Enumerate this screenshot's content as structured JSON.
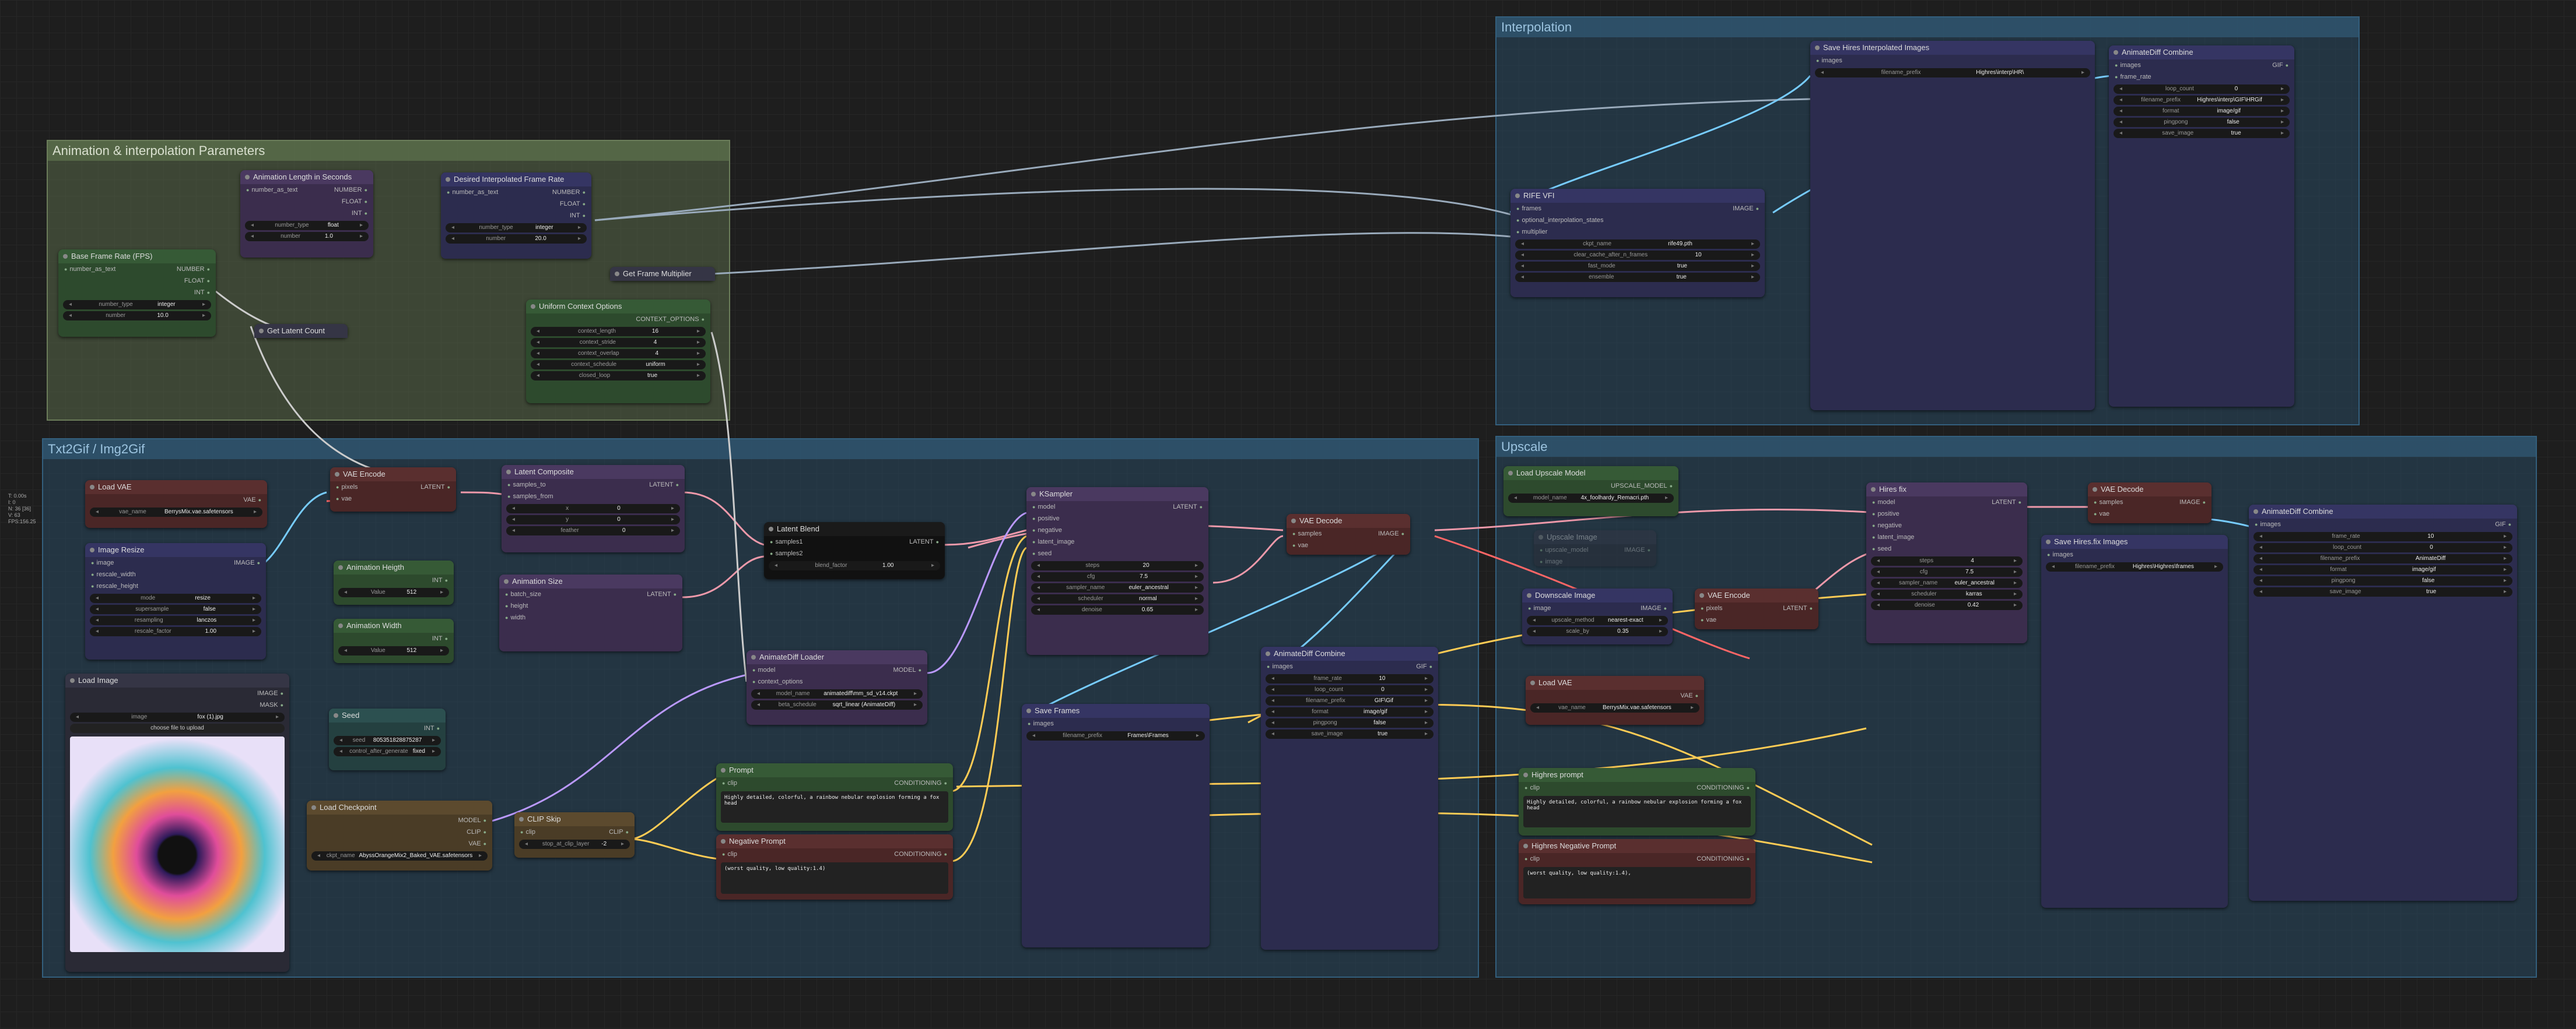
{
  "groups": {
    "interpolation": "Interpolation",
    "anim_params": "Animation & interpolation Parameters",
    "txt2gif": "Txt2Gif / Img2Gif",
    "upscale": "Upscale"
  },
  "sidebar": [
    "T: 0.00s",
    "I: 0",
    "N: 36 [36]",
    "V: 63",
    "FPS:156.25"
  ],
  "nodes": {
    "anim_length": {
      "title": "Animation Length in Seconds",
      "in": "number_as_text",
      "outs": [
        "NUMBER",
        "FLOAT",
        "INT"
      ],
      "w": [
        [
          "number_type",
          "float"
        ],
        [
          "number",
          "1.0"
        ]
      ]
    },
    "desired_fps": {
      "title": "Desired Interpolated Frame Rate",
      "in": "number_as_text",
      "outs": [
        "NUMBER",
        "FLOAT",
        "INT"
      ],
      "w": [
        [
          "number_type",
          "integer"
        ],
        [
          "number",
          "20.0"
        ]
      ]
    },
    "base_fps": {
      "title": "Base Frame Rate (FPS)",
      "in": "number_as_text",
      "outs": [
        "NUMBER",
        "FLOAT",
        "INT"
      ],
      "w": [
        [
          "number_type",
          "integer"
        ],
        [
          "number",
          "10.0"
        ]
      ]
    },
    "latent_count": {
      "title": "Get Latent Count"
    },
    "frame_mult": {
      "title": "Get Frame Multiplier"
    },
    "uniform_ctx": {
      "title": "Uniform Context Options",
      "out": "CONTEXT_OPTIONS",
      "w": [
        [
          "context_length",
          "16"
        ],
        [
          "context_stride",
          "4"
        ],
        [
          "context_overlap",
          "4"
        ],
        [
          "context_schedule",
          "uniform"
        ],
        [
          "closed_loop",
          "true"
        ]
      ]
    },
    "rife": {
      "title": "RIFE VFI",
      "ins": [
        "frames",
        "optional_interpolation_states",
        "multiplier"
      ],
      "out": "IMAGE",
      "w": [
        [
          "ckpt_name",
          "rife49.pth"
        ],
        [
          "clear_cache_after_n_frames",
          "10"
        ],
        [
          "fast_mode",
          "true"
        ],
        [
          "ensemble",
          "true"
        ]
      ]
    },
    "save_hires_interp": {
      "title": "Save Hires Interpolated Images",
      "in": "images",
      "w": [
        [
          "filename_prefix",
          "Highres\\interp\\HR\\"
        ]
      ]
    },
    "combine1": {
      "title": "AnimateDiff Combine",
      "in": "images",
      "out": "GIF",
      "w": [
        [
          "loop_count",
          "0"
        ],
        [
          "filename_prefix",
          "Highres\\interp\\GIF\\HRGif"
        ],
        [
          "format",
          "image/gif"
        ],
        [
          "pingpong",
          "false"
        ],
        [
          "save_image",
          "true"
        ]
      ],
      "extra": "frame_rate"
    },
    "load_vae": {
      "title": "Load VAE",
      "out": "VAE",
      "w": [
        [
          "vae_name",
          "BerrysMix.vae.safetensors"
        ]
      ]
    },
    "image_resize": {
      "title": "Image Resize",
      "ins": [
        "image",
        "rescale_width",
        "rescale_height"
      ],
      "out": "IMAGE",
      "w": [
        [
          "mode",
          "resize"
        ],
        [
          "supersample",
          "false"
        ],
        [
          "resampling",
          "lanczos"
        ],
        [
          "rescale_factor",
          "1.00"
        ]
      ]
    },
    "load_image": {
      "title": "Load Image",
      "outs": [
        "IMAGE",
        "MASK"
      ],
      "w": [
        [
          "image",
          "fox (1).jpg"
        ]
      ],
      "upload": "choose file to upload"
    },
    "vae_encode": {
      "title": "VAE Encode",
      "ins": [
        "pixels",
        "vae"
      ],
      "out": "LATENT"
    },
    "anim_height": {
      "title": "Animation Heigth",
      "out": "INT",
      "w": [
        [
          "Value",
          "512"
        ]
      ]
    },
    "anim_width": {
      "title": "Animation Width",
      "out": "INT",
      "w": [
        [
          "Value",
          "512"
        ]
      ]
    },
    "latent_composite": {
      "title": "Latent Composite",
      "ins": [
        "samples_to",
        "samples_from"
      ],
      "out": "LATENT",
      "w": [
        [
          "x",
          "0"
        ],
        [
          "y",
          "0"
        ],
        [
          "feather",
          "0"
        ]
      ]
    },
    "anim_size": {
      "title": "Animation Size",
      "ins": [
        "batch_size",
        "height",
        "width"
      ],
      "out": "LATENT"
    },
    "latent_blend": {
      "title": "Latent Blend",
      "ins": [
        "samples1",
        "samples2"
      ],
      "out": "LATENT",
      "w": [
        [
          "blend_factor",
          "1.00"
        ]
      ]
    },
    "seed": {
      "title": "Seed",
      "out": "INT",
      "w": [
        [
          "seed",
          "805351828875287"
        ],
        [
          "control_after_generate",
          "fixed"
        ]
      ]
    },
    "ad_loader": {
      "title": "AnimateDiff Loader",
      "ins": [
        "model",
        "context_options"
      ],
      "out": "MODEL",
      "w": [
        [
          "model_name",
          "animatediff\\mm_sd_v14.ckpt"
        ],
        [
          "beta_schedule",
          "sqrt_linear (AnimateDiff)"
        ]
      ]
    },
    "ksampler": {
      "title": "KSampler",
      "ins": [
        "model",
        "positive",
        "negative",
        "latent_image",
        "seed"
      ],
      "out": "LATENT",
      "w": [
        [
          "steps",
          "20"
        ],
        [
          "cfg",
          "7.5"
        ],
        [
          "sampler_name",
          "euler_ancestral"
        ],
        [
          "scheduler",
          "normal"
        ],
        [
          "denoise",
          "0.65"
        ]
      ]
    },
    "vae_decode1": {
      "title": "VAE Decode",
      "ins": [
        "samples",
        "vae"
      ],
      "out": "IMAGE"
    },
    "load_ckpt": {
      "title": "Load Checkpoint",
      "outs": [
        "MODEL",
        "CLIP",
        "VAE"
      ],
      "w": [
        [
          "ckpt_name",
          "AbyssOrangeMix2_Baked_VAE.safetensors"
        ]
      ]
    },
    "clip_skip": {
      "title": "CLIP Skip",
      "in": "clip",
      "out": "CLIP",
      "w": [
        [
          "stop_at_clip_layer",
          "-2"
        ]
      ]
    },
    "prompt": {
      "title": "Prompt",
      "in": "clip",
      "out": "CONDITIONING",
      "text": "Highly detailed, colorful, a rainbow nebular explosion forming a fox head"
    },
    "neg_prompt": {
      "title": "Negative Prompt",
      "in": "clip",
      "out": "CONDITIONING",
      "text": "(worst quality, low quality:1.4)"
    },
    "save_frames": {
      "title": "Save Frames",
      "in": "images",
      "w": [
        [
          "filename_prefix",
          "Frames\\Frames"
        ]
      ]
    },
    "combine2": {
      "title": "AnimateDiff Combine",
      "in": "images",
      "out": "GIF",
      "w": [
        [
          "frame_rate",
          "10"
        ],
        [
          "loop_count",
          "0"
        ],
        [
          "filename_prefix",
          "GIF\\Gif"
        ],
        [
          "format",
          "image/gif"
        ],
        [
          "pingpong",
          "false"
        ],
        [
          "save_image",
          "true"
        ]
      ]
    },
    "load_upscale": {
      "title": "Load Upscale Model",
      "out": "UPSCALE_MODEL",
      "w": [
        [
          "model_name",
          "4x_foolhardy_Remacri.pth"
        ]
      ]
    },
    "upscale_image": {
      "title": "Upscale Image",
      "ins": [
        "upscale_model",
        "image"
      ],
      "out": "IMAGE"
    },
    "downscale": {
      "title": "Downscale Image",
      "in": "image",
      "out": "IMAGE",
      "w": [
        [
          "upscale_method",
          "nearest-exact"
        ],
        [
          "scale_by",
          "0.35"
        ]
      ]
    },
    "vae_encode2": {
      "title": "VAE Encode",
      "ins": [
        "pixels",
        "vae"
      ],
      "out": "LATENT"
    },
    "load_vae2": {
      "title": "Load VAE",
      "out": "VAE",
      "w": [
        [
          "vae_name",
          "BerrysMix.vae.safetensors"
        ]
      ]
    },
    "hires_prompt": {
      "title": "Highres prompt",
      "in": "clip",
      "out": "CONDITIONING",
      "text": "Highly detailed, colorful, a rainbow nebular explosion forming a fox head"
    },
    "hires_neg": {
      "title": "Highres Negative Prompt",
      "in": "clip",
      "out": "CONDITIONING",
      "text": "(worst quality, low quality:1.4),"
    },
    "hires_fix": {
      "title": "Hires fix",
      "ins": [
        "model",
        "positive",
        "negative",
        "latent_image",
        "seed"
      ],
      "out": "LATENT",
      "w": [
        [
          "steps",
          "4"
        ],
        [
          "cfg",
          "7.5"
        ],
        [
          "sampler_name",
          "euler_ancestral"
        ],
        [
          "scheduler",
          "karras"
        ],
        [
          "denoise",
          "0.42"
        ]
      ]
    },
    "vae_decode2": {
      "title": "VAE Decode",
      "ins": [
        "samples",
        "vae"
      ],
      "out": "IMAGE"
    },
    "save_hires": {
      "title": "Save Hires.fix Images",
      "in": "images",
      "w": [
        [
          "filename_prefix",
          "Highres\\Highres\\frames"
        ]
      ]
    },
    "combine3": {
      "title": "AnimateDiff Combine",
      "in": "images",
      "out": "GIF",
      "w": [
        [
          "frame_rate",
          "10"
        ],
        [
          "loop_count",
          "0"
        ],
        [
          "filename_prefix",
          "AnimateDiff"
        ],
        [
          "format",
          "image/gif"
        ],
        [
          "pingpong",
          "false"
        ],
        [
          "save_image",
          "true"
        ]
      ]
    }
  }
}
